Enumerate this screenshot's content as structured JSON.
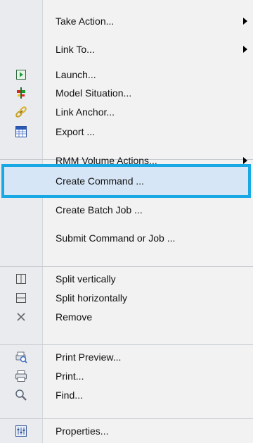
{
  "menu": {
    "items": [
      {
        "label": "Take Action...",
        "icon": "",
        "submenu": true
      },
      {
        "label": "Link To...",
        "icon": "",
        "submenu": true
      },
      {
        "label": "Launch...",
        "icon": "launch-icon",
        "submenu": false
      },
      {
        "label": "Model Situation...",
        "icon": "model-situation-icon",
        "submenu": false
      },
      {
        "label": "Link Anchor...",
        "icon": "link-anchor-icon",
        "submenu": false
      },
      {
        "label": "Export ...",
        "icon": "export-icon",
        "submenu": false
      },
      {
        "label": "RMM Volume Actions...",
        "icon": "",
        "submenu": true
      },
      {
        "label": "Create Command ...",
        "icon": "",
        "submenu": false,
        "highlighted": true
      },
      {
        "label": "Create Batch Job ...",
        "icon": "",
        "submenu": false
      },
      {
        "label": "Submit Command or Job ...",
        "icon": "",
        "submenu": false
      },
      {
        "label": "Split vertically",
        "icon": "split-vertical-icon",
        "submenu": false
      },
      {
        "label": "Split horizontally",
        "icon": "split-horizontal-icon",
        "submenu": false
      },
      {
        "label": "Remove",
        "icon": "remove-icon",
        "submenu": false
      },
      {
        "label": "Print Preview...",
        "icon": "print-preview-icon",
        "submenu": false
      },
      {
        "label": "Print...",
        "icon": "print-icon",
        "submenu": false
      },
      {
        "label": "Find...",
        "icon": "find-icon",
        "submenu": false
      },
      {
        "label": "Properties...",
        "icon": "properties-icon",
        "submenu": false
      }
    ]
  },
  "colors": {
    "highlight_border": "#18a8e4",
    "highlight_fill": "#d6e6f6",
    "gutter": "#e9ebee",
    "background": "#f2f2f2"
  }
}
